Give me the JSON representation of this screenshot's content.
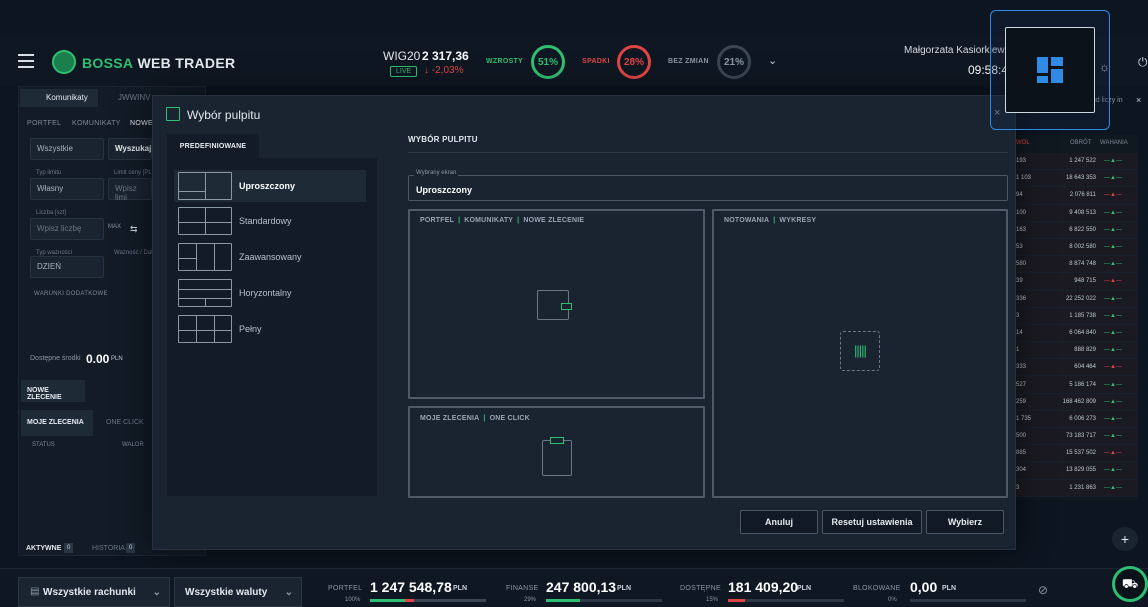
{
  "header": {
    "brand_a": "BOSSA",
    "brand_b": " WEB TRADER",
    "index_name": "WIG20",
    "index_value": "2 317,36",
    "live": "LIVE",
    "index_change": "↓ -2,03%",
    "stats": [
      {
        "label": "WZROSTY",
        "value": "51%",
        "color": "#2fbf73",
        "fraction": 0.51
      },
      {
        "label": "SPADKI",
        "value": "28%",
        "color": "#e04545",
        "fraction": 0.28
      },
      {
        "label": "BEZ ZMIAN",
        "value": "21%",
        "color": "#8a97a3",
        "fraction": 0.21
      }
    ],
    "user": "Małgorzata Kasiorkiew",
    "time": "09:58:4"
  },
  "left": {
    "tab_top": "Komunikaty",
    "tab_top2": "JWWINV",
    "tabs": [
      "PORTFEL",
      "KOMUNIKATY",
      "NOWE"
    ],
    "filter": "Wszystkie",
    "search": "Wyszukaj",
    "type_label": "Typ limitu",
    "type_val": "Własny",
    "limit_label": "Limit ceny [PLN]",
    "limit_ph": "Wpisz limi",
    "qty_label": "Liczba [szt]",
    "qty_ph": "Wpisz liczbę",
    "max": "MAX",
    "valid_label": "Typ ważności",
    "valid_val": "DZIEŃ",
    "valid2": "Ważność / Dat",
    "conds": "WARUNKI DODATKOWE",
    "avail_label": "Dostępne środki",
    "avail_val": "0.00",
    "avail_unit": "PLN",
    "new_order": "NOWE ZLECENIE",
    "orders_tab": "MOJE ZLECENIA",
    "oneclick_tab": "ONE CLICK",
    "col_status": "STATUS",
    "col_value": "WALOR",
    "active": "AKTYWNE",
    "active_n": "0",
    "history": "HISTORIA",
    "history_n": "0"
  },
  "right": {
    "cols": [
      "WOL",
      "OBRÓT",
      "WAHANIA"
    ],
    "note": "pud liczy in",
    "rows": [
      [
        "193",
        "1 247 522"
      ],
      [
        "1 103",
        "18 643 353"
      ],
      [
        "94",
        "2 076 811"
      ],
      [
        "100",
        "9 408 513"
      ],
      [
        "163",
        "6 822 550"
      ],
      [
        "53",
        "8 002 580"
      ],
      [
        "580",
        "8 874 748"
      ],
      [
        "39",
        "948 715"
      ],
      [
        "336",
        "22 252 022"
      ],
      [
        "3",
        "1 185 738"
      ],
      [
        "14",
        "6 064 840"
      ],
      [
        "1",
        "888 829"
      ],
      [
        "333",
        "604 464"
      ],
      [
        "527",
        "5 186 174"
      ],
      [
        "259",
        "168 462 809"
      ],
      [
        "1 735",
        "6 006 273"
      ],
      [
        "500",
        "73 183 717"
      ],
      [
        "885",
        "15 537 502"
      ],
      [
        "304",
        "13 829 055"
      ],
      [
        "3",
        "1 231 863"
      ]
    ]
  },
  "modal": {
    "title": "Wybór pulpitu",
    "tab": "PREDEFINIOWANE",
    "section": "WYBÓR PULPITU",
    "legend": "Wybrany ekran",
    "selected": "Uproszczony",
    "options": [
      "Uproszczony",
      "Standardowy",
      "Zaawansowany",
      "Horyzontalny",
      "Pełny"
    ],
    "slot1": [
      "PORTFEL",
      "KOMUNIKATY",
      "NOWE ZLECENIE"
    ],
    "slot2": [
      "NOTOWANIA",
      "WYKRESY"
    ],
    "slot3": [
      "MOJE ZLECENIA",
      "ONE CLICK"
    ],
    "btn_cancel": "Anuluj",
    "btn_reset": "Resetuj ustawienia",
    "btn_choose": "Wybierz",
    "close": "×"
  },
  "bottom": {
    "accounts": "Wszystkie rachunki",
    "currencies": "Wszystkie waluty",
    "stats": [
      {
        "label": "PORTFEL",
        "value": "1 247 548,78",
        "unit": "PLN",
        "pct": "100%",
        "fraction": 1.0
      },
      {
        "label": "FINANSE",
        "value": "247 800,13",
        "unit": "PLN",
        "pct": "29%",
        "fraction": 0.29
      },
      {
        "label": "DOSTĘPNE",
        "value": "181 409,20",
        "unit": "PLN",
        "pct": "15%",
        "fraction": 0.15
      },
      {
        "label": "BLOKOWANE",
        "value": "0,00",
        "unit": "PLN",
        "pct": "0%",
        "fraction": 0
      }
    ]
  },
  "colors": {
    "accent": "#2fbf73",
    "negative": "#e04545",
    "highlight": "#2f8be6"
  }
}
